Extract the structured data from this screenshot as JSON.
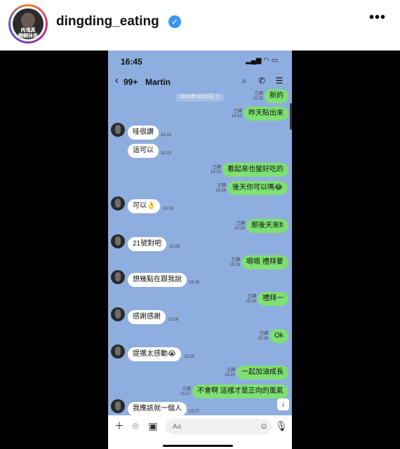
{
  "post": {
    "username": "dingding_eating",
    "avatar_text": "肉塊真鋼鋼抹茶",
    "verified_icon": "verified-check-icon",
    "more_label": "•••"
  },
  "chat": {
    "status_time": "16:45",
    "status_arrow": "◂",
    "nav": {
      "back": "‹",
      "unread": "99+",
      "name": "Martin"
    },
    "date_chip": "2019年1月19日 六",
    "input_placeholder": "Aa",
    "read_label": "已讀",
    "colors": {
      "background": "#8eaee0",
      "outgoing": "#7ee072",
      "incoming": "#ffffff"
    },
    "messages": [
      {
        "dir": "out",
        "text": "新的",
        "read": "已讀",
        "time": "15:25"
      },
      {
        "dir": "out",
        "text": "昨天貼出來",
        "read": "已讀",
        "time": "15:25"
      },
      {
        "dir": "in",
        "text": "哇很讚",
        "time": "15:25"
      },
      {
        "dir": "in",
        "text": "這可以",
        "time": "15:25"
      },
      {
        "dir": "out",
        "text": "看起來也蠻好吃的",
        "read": "已讀",
        "time": "15:25"
      },
      {
        "dir": "out",
        "text": "後天你可以嗎😂",
        "read": "已讀",
        "time": "15:26"
      },
      {
        "dir": "in",
        "text": "可以👌",
        "time": "15:26"
      },
      {
        "dir": "out",
        "text": "那後天來ft",
        "read": "已讀",
        "time": "15:26"
      },
      {
        "dir": "in",
        "text": "21號對吧",
        "time": "15:26"
      },
      {
        "dir": "out",
        "text": "嗯嗯 禮拜要",
        "read": "已讀",
        "time": "15:26"
      },
      {
        "dir": "in",
        "text": "想幾點在跟我說",
        "time": "15:26"
      },
      {
        "dir": "out",
        "text": "禮拜一",
        "read": "已讀",
        "time": "15:26"
      },
      {
        "dir": "in",
        "text": "感謝感謝",
        "time": "15:26"
      },
      {
        "dir": "out",
        "text": "Ok",
        "read": "已讀",
        "time": "15:26"
      },
      {
        "dir": "in",
        "text": "提攜太感動😭",
        "time": "15:26"
      },
      {
        "dir": "out",
        "text": "一起加油成長",
        "read": "已讀",
        "time": "15:26"
      },
      {
        "dir": "out",
        "text": "不會啊 這樣才是正向的風氣",
        "read": "已讀",
        "time": "15:27"
      },
      {
        "dir": "in",
        "text": "我應該就一個人",
        "time": "15:27"
      }
    ]
  }
}
